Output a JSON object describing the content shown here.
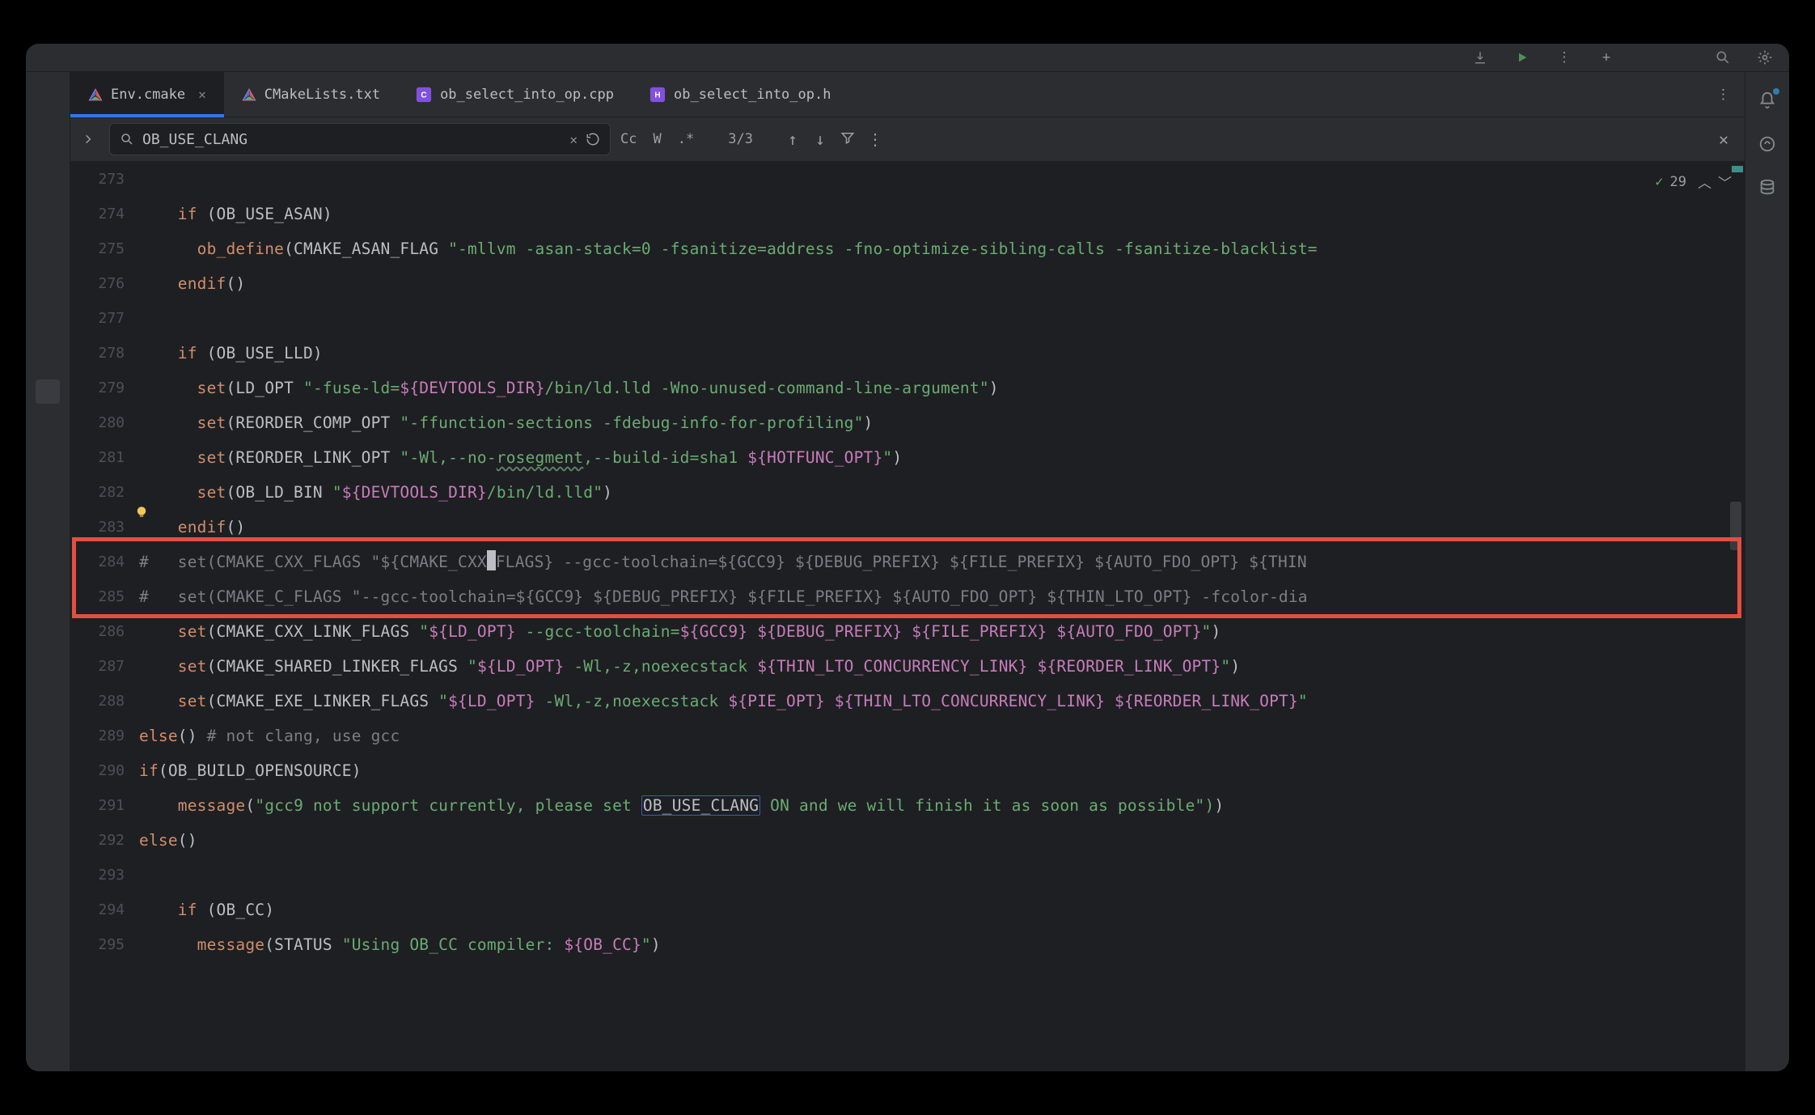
{
  "tabs": [
    {
      "label": "Env.cmake",
      "type": "cmake",
      "active": true,
      "closable": true
    },
    {
      "label": "CMakeLists.txt",
      "type": "cmake",
      "active": false,
      "closable": false
    },
    {
      "label": "ob_select_into_op.cpp",
      "type": "cpp",
      "active": false,
      "closable": false
    },
    {
      "label": "ob_select_into_op.h",
      "type": "h",
      "active": false,
      "closable": false
    }
  ],
  "search": {
    "query": "OB_USE_CLANG",
    "match_label": "3/3",
    "option_cc": "Cc",
    "option_w": "W",
    "option_regex": ".*"
  },
  "problems": {
    "count": "29"
  },
  "lines": {
    "l273": "",
    "l274_pre": "    if (OB_USE_ASAN)",
    "l275_pre": "      ob_define(CMAKE_ASAN_FLAG \"-mllvm -asan-stack=0 -fsanitize=address -fno-optimize-sibling-calls -fsanitize-blacklist=",
    "l276_pre": "    endif()",
    "l277": "",
    "l278_pre": "    if (OB_USE_LLD)",
    "l279_pre": "      set(LD_OPT \"-fuse-ld=${DEVTOOLS_DIR}/bin/ld.lld -Wno-unused-command-line-argument\")",
    "l280_pre": "      set(REORDER_COMP_OPT \"-ffunction-sections -fdebug-info-for-profiling\")",
    "l281_pre": "      set(REORDER_LINK_OPT \"-Wl,--no-rosegment,--build-id=sha1 ${HOTFUNC_OPT}\")",
    "l282_pre": "      set(OB_LD_BIN \"${DEVTOOLS_DIR}/bin/ld.lld\")",
    "l283_pre": "    endif()",
    "l284_comment": "#   set(CMAKE_CXX_FLAGS \"${CMAKE_CXX_FLAGS} --gcc-toolchain=${GCC9} ${DEBUG_PREFIX} ${FILE_PREFIX} ${AUTO_FDO_OPT} ${THIN",
    "l285_comment": "#   set(CMAKE_C_FLAGS \"--gcc-toolchain=${GCC9} ${DEBUG_PREFIX} ${FILE_PREFIX} ${AUTO_FDO_OPT} ${THIN_LTO_OPT} -fcolor-dia",
    "l286_pre": "    set(CMAKE_CXX_LINK_FLAGS \"${LD_OPT} --gcc-toolchain=${GCC9} ${DEBUG_PREFIX} ${FILE_PREFIX} ${AUTO_FDO_OPT}\")",
    "l287_pre": "    set(CMAKE_SHARED_LINKER_FLAGS \"${LD_OPT} -Wl,-z,noexecstack ${THIN_LTO_CONCURRENCY_LINK} ${REORDER_LINK_OPT}\")",
    "l288_pre": "    set(CMAKE_EXE_LINKER_FLAGS \"${LD_OPT} -Wl,-z,noexecstack ${PIE_OPT} ${THIN_LTO_CONCURRENCY_LINK} ${REORDER_LINK_OPT}\" ",
    "l289_else": "else",
    "l289_comment": " # not clang, use gcc",
    "l290_pre": "if(OB_BUILD_OPENSOURCE)",
    "l291_a": "    message(\"gcc9 not support currently, please set ",
    "l291_hl": "OB_USE_CLANG",
    "l291_b": " ON and we will finish it as soon as possible\")",
    "l292_pre": "else()",
    "l293": "",
    "l294_pre": "    if (OB_CC)",
    "l295_pre": "      message(STATUS \"Using OB_CC compiler: ${OB_CC}\")"
  },
  "line_numbers": [
    "273",
    "274",
    "275",
    "276",
    "277",
    "278",
    "279",
    "280",
    "281",
    "282",
    "283",
    "284",
    "285",
    "286",
    "287",
    "288",
    "289",
    "290",
    "291",
    "292",
    "293",
    "294",
    "295"
  ]
}
